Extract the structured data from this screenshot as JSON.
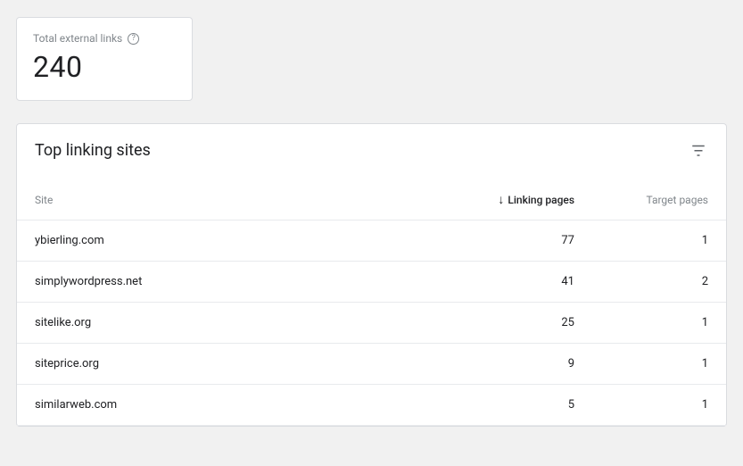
{
  "stat": {
    "label": "Total external links",
    "value": "240"
  },
  "table": {
    "title": "Top linking sites",
    "columns": {
      "site": "Site",
      "linking": "Linking pages",
      "target": "Target pages"
    },
    "rows": [
      {
        "site": "ybierling.com",
        "linking": "77",
        "target": "1"
      },
      {
        "site": "simplywordpress.net",
        "linking": "41",
        "target": "2"
      },
      {
        "site": "sitelike.org",
        "linking": "25",
        "target": "1"
      },
      {
        "site": "siteprice.org",
        "linking": "9",
        "target": "1"
      },
      {
        "site": "similarweb.com",
        "linking": "5",
        "target": "1"
      }
    ]
  }
}
